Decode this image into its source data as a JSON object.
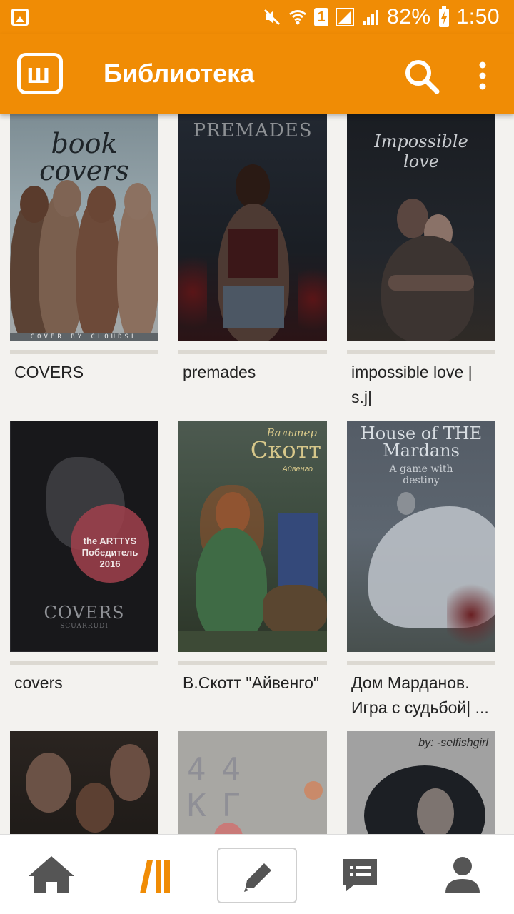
{
  "status_bar": {
    "battery": "82%",
    "time": "1:50",
    "sim": "1",
    "icons": [
      "gallery-notification-icon",
      "mute-icon",
      "wifi-icon",
      "sim-icon",
      "signal-icon",
      "signal-icon",
      "battery-charging-icon"
    ]
  },
  "app_bar": {
    "title": "Библиотека",
    "logo_letter": "ш",
    "icons": [
      "wattpad-logo-icon",
      "search-icon",
      "more-vert-icon"
    ]
  },
  "books": [
    {
      "title": "COVERS",
      "cover_text": "book covers",
      "cover_footer": "COVER BY CLOUDSL",
      "cover_color": "#8f9ea7"
    },
    {
      "title": "premades",
      "cover_text": "PREMADES",
      "cover_footer": "",
      "cover_color": "#1b1f24"
    },
    {
      "title": "impossible love | s.j|",
      "cover_text": "Impossible love",
      "cover_footer": "",
      "cover_color": "#1c1f25"
    },
    {
      "title": "covers",
      "cover_text": "COVERS",
      "cover_footer": "SCUARRUDI",
      "cover_color": "#1a1a1d",
      "badge": "the ARTTYS Победитель 2016"
    },
    {
      "title": "В.Скотт \"Айвенго\"",
      "cover_text": "Скотт",
      "cover_pretext": "Вальтер",
      "cover_footer": "Айвенго",
      "cover_color": "#3a4a35"
    },
    {
      "title": "Дом Марданов. Игра с судьбой| ...",
      "cover_text": "House of THE Mardans",
      "cover_footer": "A game with destiny",
      "cover_color": "#5a6470"
    },
    {
      "title": "",
      "cover_text": "",
      "cover_footer": "",
      "cover_color": "#2a2420"
    },
    {
      "title": "",
      "cover_text": "44 КГ",
      "cover_footer": "",
      "cover_color": "#a9a8a4"
    },
    {
      "title": "",
      "cover_text": "by: -selfishgirl",
      "cover_footer": "",
      "cover_color": "#9a9a9a"
    }
  ],
  "bottom_nav": {
    "items": [
      "home-icon",
      "library-icon",
      "write-icon",
      "messages-icon",
      "profile-icon"
    ],
    "active": "library-icon",
    "accent": "#f08c05"
  },
  "colors": {
    "brand": "#f08c05",
    "background": "#f3f2ef"
  }
}
